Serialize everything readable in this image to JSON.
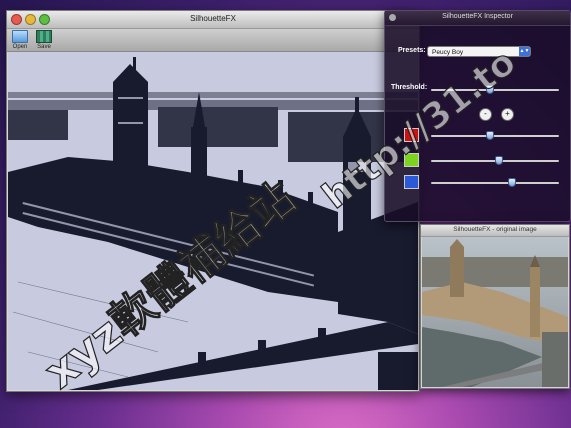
{
  "main_window": {
    "title": "SilhouetteFX",
    "toolbar": {
      "open_label": "Open",
      "save_label": "Save"
    }
  },
  "inspector": {
    "title": "SilhouetteFX Inspector",
    "presets_label": "Presets:",
    "preset_value": "Peucy Boy",
    "threshold_label": "Threshold:",
    "minus_label": "-",
    "plus_label": "+",
    "sliders": {
      "threshold": 0.46,
      "color1": 0.46,
      "color2": 0.53,
      "color3": 0.63
    },
    "swatches": [
      "#d01010",
      "#7ed321",
      "#2a5ad8"
    ]
  },
  "original_window": {
    "title": "SilhouetteFX - original image"
  },
  "watermark": {
    "site_text": "xyz軟體補給站",
    "url_text": "http://31.to"
  },
  "colors": {
    "silhouette_dark": "#181a2e",
    "silhouette_light": "#c8cadf"
  }
}
